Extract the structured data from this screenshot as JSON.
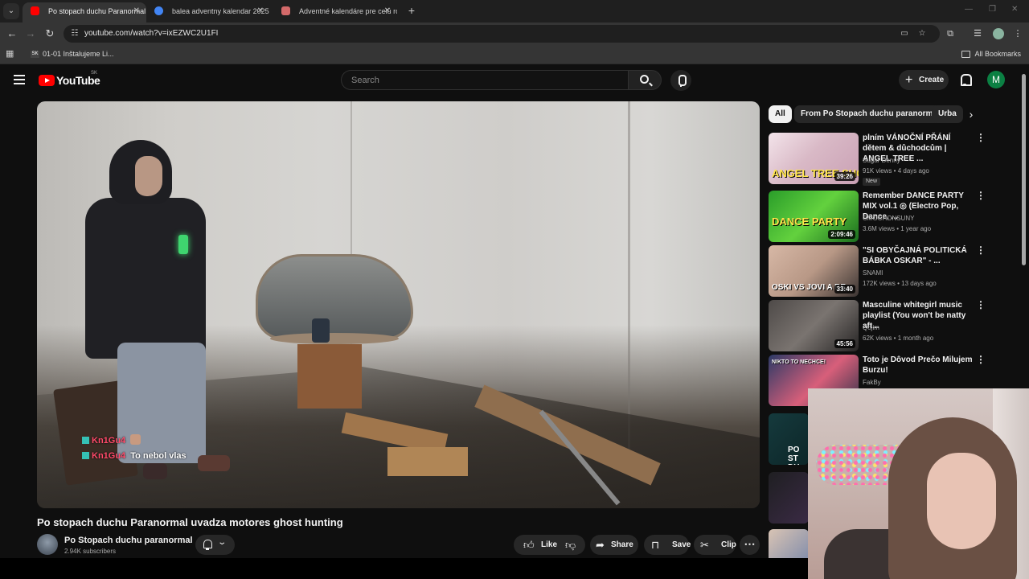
{
  "browser": {
    "tabs": [
      {
        "title": "Po stopach duchu Paranormal u",
        "active": true
      },
      {
        "title": "balea adventny kalendar 2025",
        "active": false
      },
      {
        "title": "Adventné kalendáre pre celú ro",
        "active": false
      }
    ],
    "url": "youtube.com/watch?v=ixEZWC2U1FI",
    "bookmarks": [
      {
        "label": "01-01 Inštalujeme Li..."
      }
    ],
    "all_bookmarks_label": "All Bookmarks"
  },
  "youtube": {
    "logo_text": "YouTube",
    "country_code": "SK",
    "search_placeholder": "Search",
    "create_label": "Create",
    "avatar_letter": "M",
    "brand_color": "#ff0000"
  },
  "video": {
    "title": "Po stopach duchu Paranormal uvadza motores ghost hunting",
    "channel_name": "Po Stopach duchu paranormal",
    "subscribers": "2.94K subscribers",
    "actions": {
      "like": "Like",
      "share": "Share",
      "save": "Save",
      "clip": "Clip"
    },
    "chat": [
      {
        "user": "Kn1Gu4",
        "message": ""
      },
      {
        "user": "Kn1Gu4",
        "message": "To nebol vlas"
      }
    ]
  },
  "sidebar": {
    "chips": [
      {
        "label": "All",
        "selected": true
      },
      {
        "label": "From Po Stopach duchu paranormal",
        "selected": false
      },
      {
        "label": "Urba",
        "selected": false
      }
    ],
    "recommendations": [
      {
        "title": "plním VÁNOČNÍ PŘÁNÍ dětem & důchodcům | ANGEL TREE ...",
        "channel": "Sugar Denny",
        "meta": "91K views • 4 days ago",
        "duration": "39:26",
        "badge": "New",
        "thumb_text": "ANGEL TREE SHOPPING"
      },
      {
        "title": "Remember DANCE PARTY MIX vol.1 ◎ (Electro Pop, Dance, ...",
        "channel": "CMOCHONSUNY",
        "meta": "3.6M views • 1 year ago",
        "duration": "2:09:46",
        "badge": "",
        "thumb_text": "DANCE PARTY"
      },
      {
        "title": "\"SI OBYČAJNÁ POLITICKÁ BÁBKA OSKAR\" - ...",
        "channel": "SNAMI",
        "meta": "172K views • 13 days ago",
        "duration": "33:40",
        "badge": "",
        "thumb_text": "OSKI VS JOVI A BE"
      },
      {
        "title": "Masculine whitegirl music playlist (You won't be natty aft...",
        "channel": "Qojim",
        "meta": "62K views • 1 month ago",
        "duration": "45:56",
        "badge": "",
        "thumb_text": ""
      },
      {
        "title": "Toto je Dôvod Prečo Milujem Burzu!",
        "channel": "FakBy",
        "meta": "",
        "duration": "",
        "badge": "",
        "thumb_text": "NIKTO TO NECHCE!"
      }
    ],
    "partial_thumb_texts": [
      "PO ST DU",
      "",
      ""
    ]
  }
}
